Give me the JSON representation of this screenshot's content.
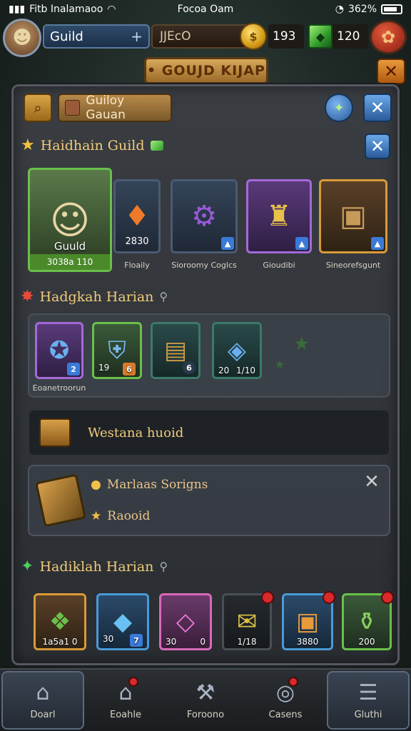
{
  "status_bar": {
    "carrier": "Fitb Inalamaoo",
    "time": "Focoa Oam",
    "battery": "362%"
  },
  "top_bar": {
    "guild_label": "Guild",
    "guild_plus": "+",
    "search_text": "JJEcO",
    "coins": "193",
    "gems": "120"
  },
  "banner": {
    "title": "• GOUJD KIJAP"
  },
  "panel_header": {
    "guild_button_label": "Guiloy Gauan"
  },
  "section1": {
    "title": "Haidhain Guild",
    "cards": [
      {
        "caption": "",
        "overlay_title": "Guuld",
        "overlay_sub": "3038a 110"
      },
      {
        "caption": "Floaily",
        "overlay_title": "2830"
      },
      {
        "caption": "Sioroomy Coglcs"
      },
      {
        "caption": "Gioudibi"
      },
      {
        "caption": "Sineorefsgunt"
      }
    ]
  },
  "section2": {
    "title": "Hadgkah Harian",
    "items": [
      {
        "label": "Eoanetroorun",
        "badge": "2"
      },
      {
        "num_left": "19",
        "badge": "6"
      },
      {
        "badge": "6"
      },
      {
        "num_left": "20",
        "num_right": "1/10"
      }
    ]
  },
  "western_row": {
    "text": "Westana huoid"
  },
  "info_box": {
    "line1": "Marlaas Sorigns",
    "line2": "Raooid"
  },
  "section3": {
    "title": "Hadiklah Harian",
    "items": [
      {
        "num": "1a5a1 0"
      },
      {
        "num_left": "30",
        "num_right": "7"
      },
      {
        "num_left": "30",
        "num_right": "0"
      },
      {
        "num": "1/18"
      },
      {
        "num": "3880"
      },
      {
        "num": "200"
      }
    ]
  },
  "bottom_nav": {
    "items": [
      {
        "label": "Doarl"
      },
      {
        "label": "Eoahle"
      },
      {
        "label": "Foroono"
      },
      {
        "label": "Casens"
      },
      {
        "label": "Gluthi"
      }
    ]
  }
}
